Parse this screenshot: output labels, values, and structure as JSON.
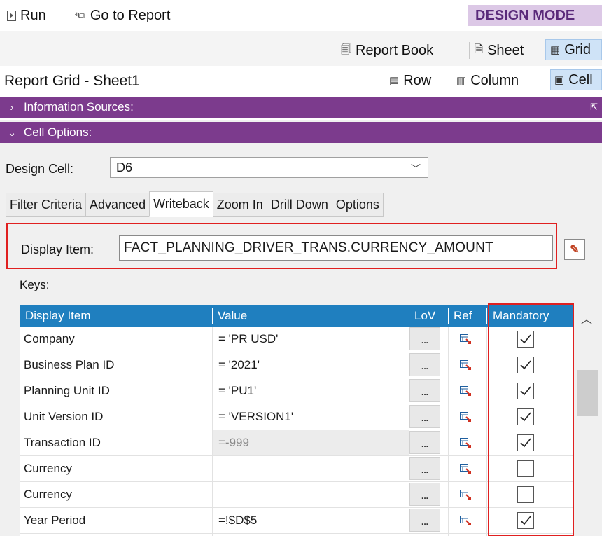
{
  "toolbar": {
    "run_label": "Run",
    "go_to_report_label": "Go to Report",
    "mode_label": "DESIGN MODE"
  },
  "views": {
    "report_book": "Report Book",
    "sheet": "Sheet",
    "grid": "Grid",
    "row": "Row",
    "column": "Column",
    "cell": "Cell"
  },
  "page_title": "Report Grid - Sheet1",
  "sections": {
    "information_sources": "Information Sources:",
    "cell_options": "Cell Options:"
  },
  "design_cell": {
    "label": "Design Cell:",
    "value": "D6"
  },
  "tabs": [
    "Filter Criteria",
    "Advanced",
    "Writeback",
    "Zoom In",
    "Drill Down",
    "Options"
  ],
  "active_tab": "Writeback",
  "display_item": {
    "label": "Display Item:",
    "value": "FACT_PLANNING_DRIVER_TRANS.CURRENCY_AMOUNT"
  },
  "keys_label": "Keys:",
  "grid": {
    "columns": [
      "Display Item",
      "Value",
      "LoV",
      "Ref",
      "Mandatory"
    ],
    "lov_button": "...",
    "rows": [
      {
        "item": "Company",
        "value": "= 'PR USD'",
        "mandatory": true,
        "disabled": false
      },
      {
        "item": "Business Plan ID",
        "value": "= '2021'",
        "mandatory": true,
        "disabled": false
      },
      {
        "item": "Planning Unit ID",
        "value": "= 'PU1'",
        "mandatory": true,
        "disabled": false
      },
      {
        "item": "Unit Version ID",
        "value": "= 'VERSION1'",
        "mandatory": true,
        "disabled": false
      },
      {
        "item": "Transaction ID",
        "value": "=-999",
        "mandatory": true,
        "disabled": true
      },
      {
        "item": "Currency",
        "value": "",
        "mandatory": false,
        "disabled": false
      },
      {
        "item": "Currency",
        "value": "",
        "mandatory": false,
        "disabled": false
      },
      {
        "item": "Year Period",
        "value": "=!$D$5",
        "mandatory": true,
        "disabled": false
      }
    ]
  },
  "colors": {
    "accent_purple": "#7c3b8d",
    "grid_header": "#1f7fbf",
    "highlight_red": "#e02020"
  }
}
